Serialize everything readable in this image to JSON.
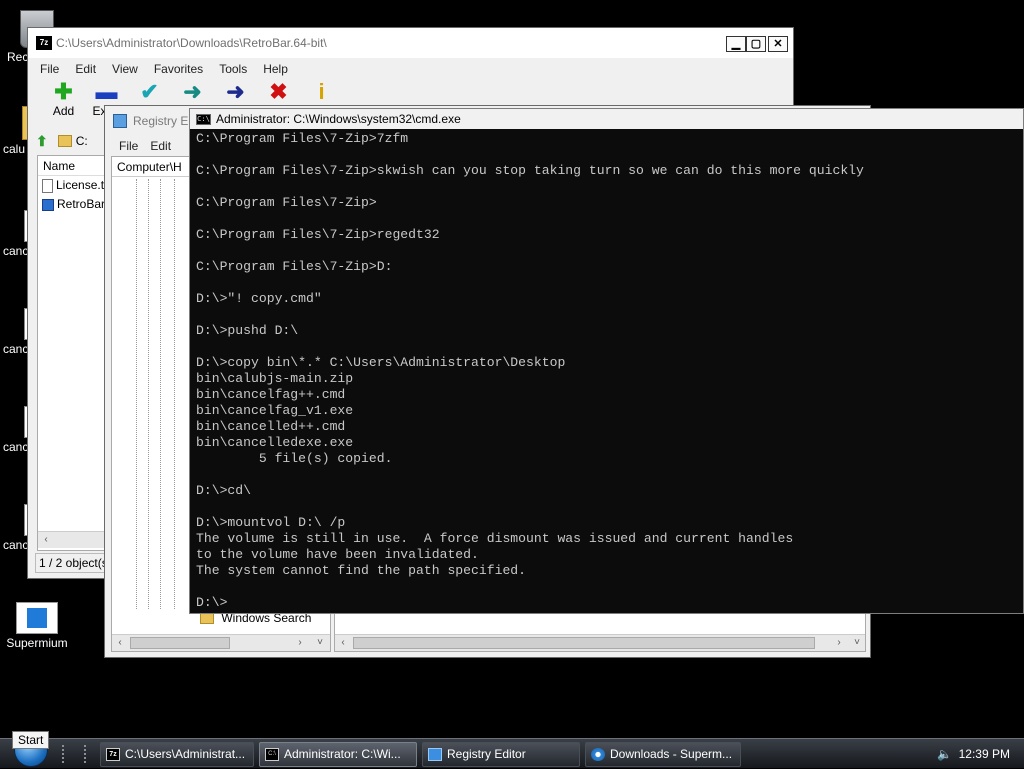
{
  "desktop": {
    "icons": [
      {
        "label": "Rec"
      },
      {
        "label": "calu"
      },
      {
        "label": "canc"
      },
      {
        "label": "canc"
      },
      {
        "label": "canc"
      },
      {
        "label": "canc"
      },
      {
        "label": "Supermium"
      }
    ]
  },
  "zip_window": {
    "title": "C:\\Users\\Administrator\\Downloads\\RetroBar.64-bit\\",
    "menu": [
      "File",
      "Edit",
      "View",
      "Favorites",
      "Tools",
      "Help"
    ],
    "toolbar": [
      {
        "label": "Add",
        "icon": "plus-icon",
        "color": "#1fa81f",
        "glyph": "✚"
      },
      {
        "label": "Extra",
        "icon": "minus-icon",
        "color": "#1b3fbf",
        "glyph": "▬"
      },
      {
        "label": "",
        "icon": "check-icon",
        "color": "#1aa5b5",
        "glyph": "✔"
      },
      {
        "label": "",
        "icon": "copy-arrow-icon",
        "color": "#178a84",
        "glyph": "➜"
      },
      {
        "label": "",
        "icon": "move-arrow-icon",
        "color": "#1d2b8f",
        "glyph": "➜"
      },
      {
        "label": "",
        "icon": "delete-icon",
        "color": "#d01010",
        "glyph": "✖"
      },
      {
        "label": "",
        "icon": "info-icon",
        "color": "#d6a400",
        "glyph": "i"
      }
    ],
    "address": "C:",
    "column_name": "Name",
    "files": [
      "License.t",
      "RetroBar"
    ],
    "status": "1 / 2 object(s"
  },
  "registry_window": {
    "title": "Registry E",
    "menu": [
      "File",
      "Edit"
    ],
    "tree_header": "Computer\\H",
    "tree_item": "Windows Search"
  },
  "cmd_window": {
    "title": "Administrator: C:\\Windows\\system32\\cmd.exe",
    "lines": [
      "C:\\Program Files\\7-Zip>7zfm",
      "",
      "C:\\Program Files\\7-Zip>skwish can you stop taking turn so we can do this more quickly",
      "",
      "C:\\Program Files\\7-Zip>",
      "",
      "C:\\Program Files\\7-Zip>regedt32",
      "",
      "C:\\Program Files\\7-Zip>D:",
      "",
      "D:\\>\"! copy.cmd\"",
      "",
      "D:\\>pushd D:\\",
      "",
      "D:\\>copy bin\\*.* C:\\Users\\Administrator\\Desktop",
      "bin\\calubjs-main.zip",
      "bin\\cancelfag++.cmd",
      "bin\\cancelfag_v1.exe",
      "bin\\cancelled++.cmd",
      "bin\\cancelledexe.exe",
      "        5 file(s) copied.",
      "",
      "D:\\>cd\\",
      "",
      "D:\\>mountvol D:\\ /p",
      "The volume is still in use.  A force dismount was issued and current handles",
      "to the volume have been invalidated.",
      "The system cannot find the path specified.",
      "",
      "D:\\>"
    ]
  },
  "taskbar": {
    "start_tooltip": "Start",
    "tasks": [
      {
        "label": "C:\\Users\\Administrat...",
        "icon": "7zip-icon"
      },
      {
        "label": "Administrator: C:\\Wi...",
        "icon": "cmd-icon"
      },
      {
        "label": "Registry Editor",
        "icon": "registry-icon"
      },
      {
        "label": "Downloads - Superm...",
        "icon": "browser-icon"
      }
    ],
    "clock": "12:39 PM"
  }
}
